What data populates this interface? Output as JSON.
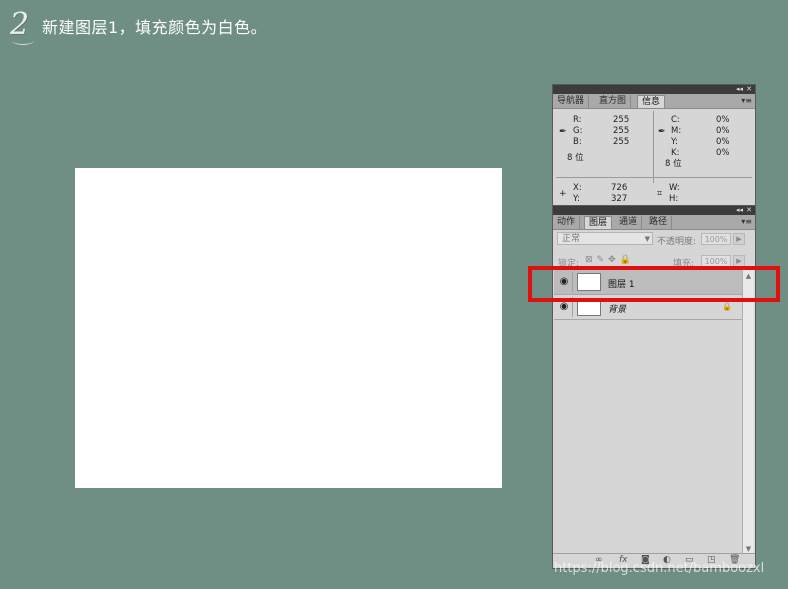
{
  "step": {
    "number": "2",
    "title": "新建图层1，填充颜色为白色。"
  },
  "info_panel": {
    "controls": {
      "collapse": "◂◂",
      "close": "✕",
      "menu": "▾≡"
    },
    "tabs": [
      {
        "label": "导航器",
        "active": false
      },
      {
        "label": "直方图",
        "active": false
      },
      {
        "label": "信息",
        "active": true
      }
    ],
    "rgb": [
      {
        "label": "R:",
        "value": "255"
      },
      {
        "label": "G:",
        "value": "255"
      },
      {
        "label": "B:",
        "value": "255"
      }
    ],
    "cmyk": [
      {
        "label": "C:",
        "value": "0%"
      },
      {
        "label": "M:",
        "value": "0%"
      },
      {
        "label": "Y:",
        "value": "0%"
      },
      {
        "label": "K:",
        "value": "0%"
      }
    ],
    "bit_left": "8 位",
    "bit_right": "8 位",
    "xy": [
      {
        "label": "X:",
        "value": "726"
      },
      {
        "label": "Y:",
        "value": "327"
      }
    ],
    "wh": [
      {
        "label": "W:",
        "value": ""
      },
      {
        "label": "H:",
        "value": ""
      }
    ],
    "icons": {
      "eyedropper": "eyedropper-icon",
      "crosshair": "crosshair-icon",
      "selection": "selection-icon"
    }
  },
  "layers_panel": {
    "controls": {
      "collapse": "◂◂",
      "close": "✕",
      "menu": "▾≡"
    },
    "tabs": [
      {
        "label": "动作",
        "active": false
      },
      {
        "label": "图层",
        "active": true
      },
      {
        "label": "通道",
        "active": false
      },
      {
        "label": "路径",
        "active": false
      }
    ],
    "blend_mode": "正常",
    "opacity_label": "不透明度:",
    "opacity_value": "100%",
    "lock_label": "锁定:",
    "lock_icons": "⊠✎✥🔒",
    "fill_label": "填充:",
    "fill_value": "100%",
    "layers": [
      {
        "name": "图层 1",
        "selected": true,
        "italic": false,
        "locked": false
      },
      {
        "name": "背景",
        "selected": false,
        "italic": true,
        "locked": true
      }
    ],
    "bottom_icons": [
      "∞",
      "fx",
      "◙",
      "◐",
      "▭",
      "◳",
      "🗑"
    ]
  },
  "watermark": "https://blog.csdn.net/bamboozxl",
  "colors": {
    "background": "#6f8f85",
    "highlight": "#e01010",
    "canvas": "#ffffff"
  }
}
